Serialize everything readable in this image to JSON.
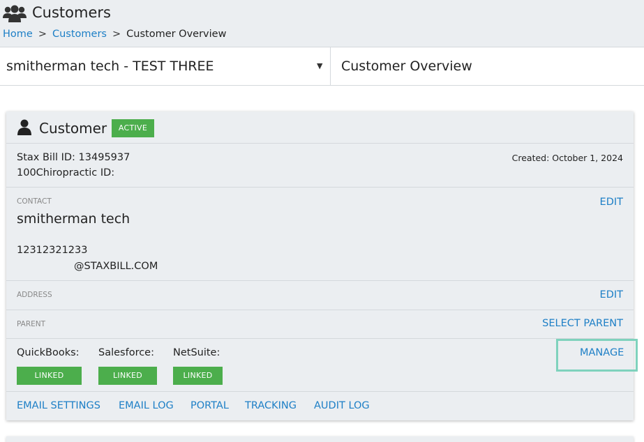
{
  "header": {
    "title": "Customers",
    "breadcrumb": [
      "Home",
      "Customers",
      "Customer Overview"
    ],
    "breadcrumb_sep": ">"
  },
  "selector": {
    "selected": "smitherman tech - TEST THREE",
    "view_title": "Customer Overview"
  },
  "customer": {
    "title": "Customer",
    "status": "ACTIVE",
    "stax_bill_id": "Stax Bill ID: 13495937",
    "chiro_id": "100Chiropractic ID:",
    "created": "Created: October 1, 2024",
    "contact": {
      "label": "CONTACT",
      "edit": "EDIT",
      "name": "smitherman tech",
      "phone": "12312321233",
      "email": "@STAXBILL.COM"
    },
    "address": {
      "label": "ADDRESS",
      "edit": "EDIT"
    },
    "parent": {
      "label": "PARENT",
      "action": "SELECT PARENT"
    },
    "integrations": {
      "items": [
        {
          "label": "QuickBooks:",
          "status": "LINKED"
        },
        {
          "label": "Salesforce:",
          "status": "LINKED"
        },
        {
          "label": "NetSuite:",
          "status": "LINKED"
        }
      ],
      "manage": "MANAGE"
    },
    "links": [
      "EMAIL SETTINGS",
      "EMAIL LOG",
      "PORTAL",
      "TRACKING",
      "AUDIT LOG"
    ]
  },
  "colors": {
    "accent_link": "#1d7fc6",
    "badge_green": "#4cae4c",
    "highlight_box": "#7fd2bd",
    "panel_bg": "#ebeef1"
  },
  "icons": {
    "header": "users-group-icon",
    "customer": "person-icon",
    "dropdown": "caret-down-icon"
  }
}
